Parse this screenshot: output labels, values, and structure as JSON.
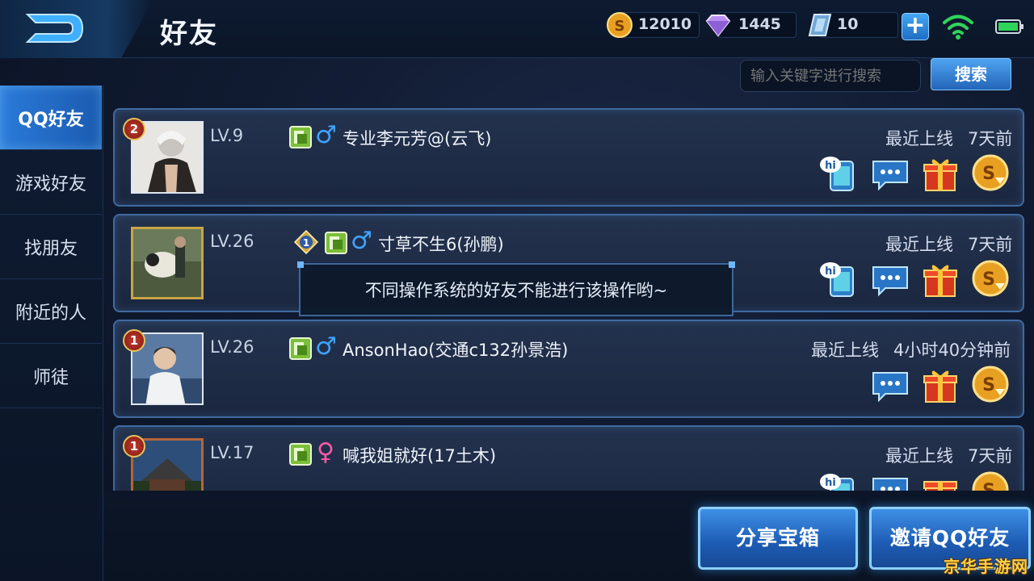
{
  "header": {
    "title": "好友",
    "gold": "12010",
    "diamonds": "1445",
    "vouchers": "10",
    "plus_label": "+"
  },
  "sidebar": {
    "items": [
      {
        "label": "QQ好友",
        "active": true
      },
      {
        "label": "游戏好友"
      },
      {
        "label": "找朋友"
      },
      {
        "label": "附近的人"
      },
      {
        "label": "师徒"
      }
    ]
  },
  "search": {
    "placeholder": "输入关键字进行搜索",
    "button_label": "搜索"
  },
  "friends": [
    {
      "rank": "2",
      "level": "LV.9",
      "gender": "♂",
      "name": "专业李元芳@(云飞)",
      "online_label": "最近上线",
      "online_time": "7天前"
    },
    {
      "rank": "",
      "level": "LV.26",
      "rank_star": "1",
      "gender": "♂",
      "name": "寸草不生6(孙鹏)",
      "online_label": "最近上线",
      "online_time": "7天前"
    },
    {
      "rank": "1",
      "level": "LV.26",
      "gender": "♂",
      "name": "AnsonHao(交通c132孙景浩)",
      "online_label": "最近上线",
      "online_time": "4小时40分钟前"
    },
    {
      "rank": "1",
      "level": "LV.17",
      "gender": "♀",
      "name": "喊我姐就好(17土木)",
      "online_label": "最近上线",
      "online_time": "7天前"
    }
  ],
  "toast": "不同操作系统的好友不能进行该操作哟~",
  "buttons": {
    "share": "分享宝箱",
    "invite": "邀请QQ好友"
  },
  "watermark": "京华手游网",
  "icons": [
    "back-icon",
    "gold-coin-icon",
    "diamond-icon",
    "voucher-icon",
    "wifi-icon",
    "battery-icon",
    "qq-icon",
    "hi-icon",
    "chat-icon",
    "gift-icon",
    "coin-send-icon"
  ],
  "colors": {
    "accent": "#2a7ad8",
    "card_border": "#3f6aa0",
    "male": "#3fa4ff",
    "female": "#ff5aa8",
    "watermark": "#ffd24a"
  }
}
